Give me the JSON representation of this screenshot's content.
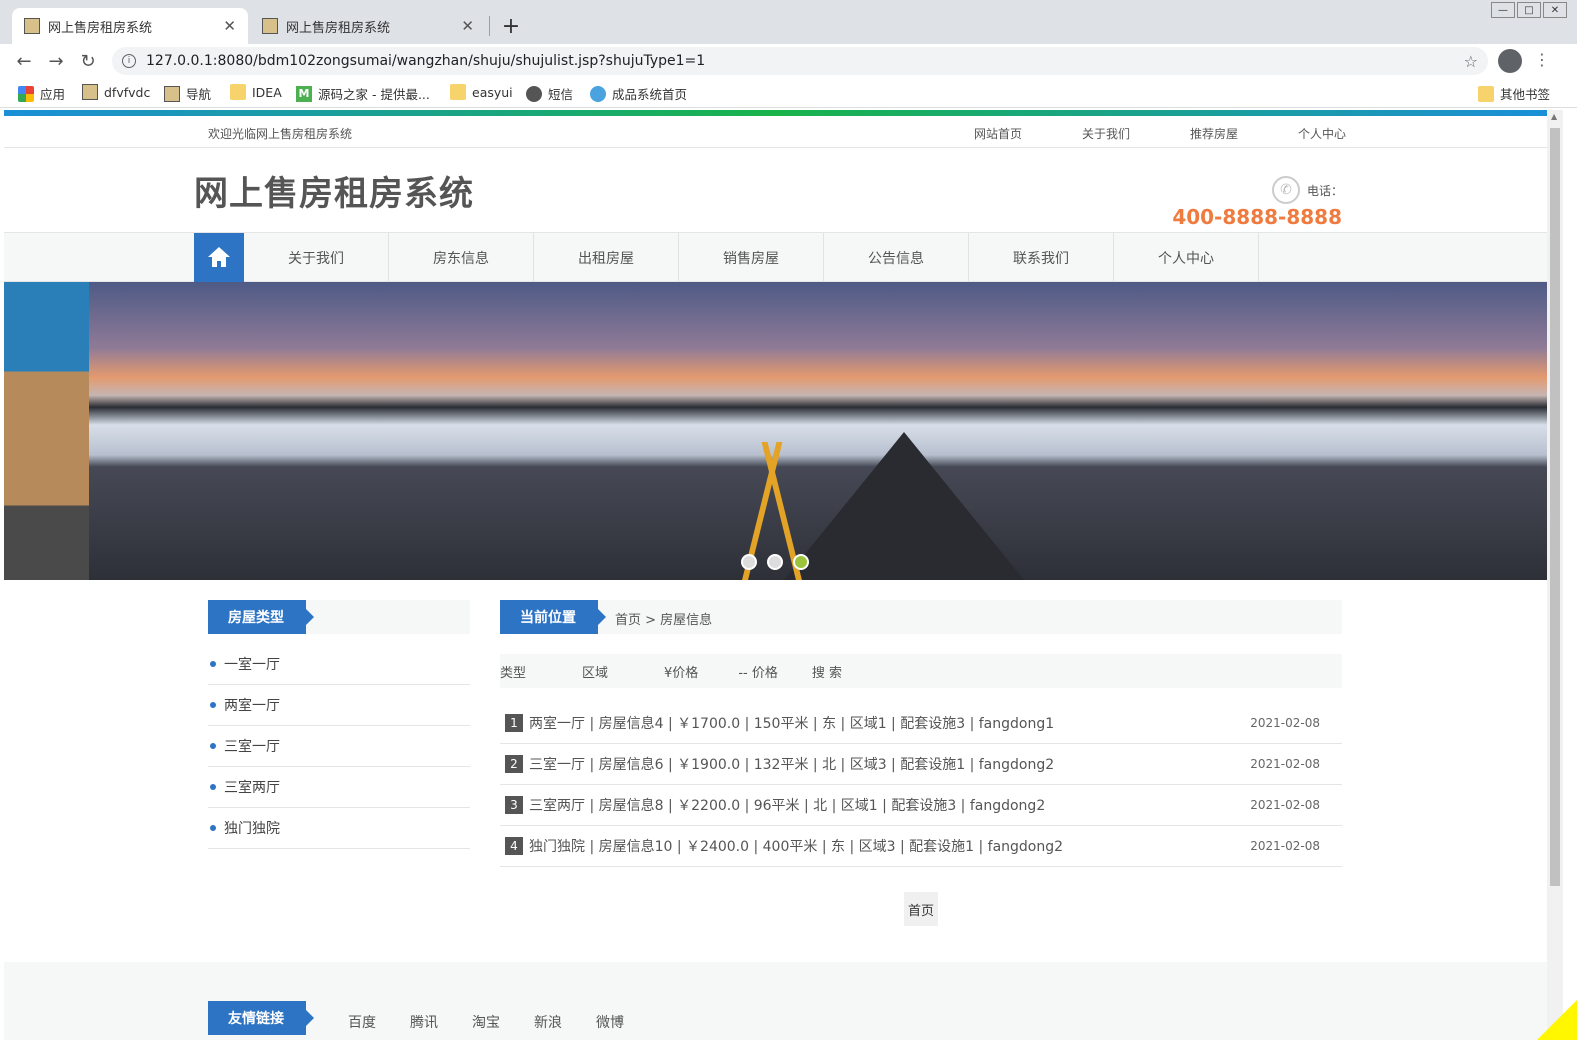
{
  "browser": {
    "tabs": [
      {
        "title": "网上售房租房系统",
        "active": true
      },
      {
        "title": "网上售房租房系统",
        "active": false
      }
    ],
    "url": "127.0.0.1:8080/bdm102zongsumai/wangzhan/shuju/shujulist.jsp?shujuType1=1",
    "bookmarks": [
      {
        "label": "应用",
        "icon": "apps-icon"
      },
      {
        "label": "dfvfvdc",
        "icon": "image-icon"
      },
      {
        "label": "导航",
        "icon": "image-icon"
      },
      {
        "label": "IDEA",
        "icon": "folder-icon"
      },
      {
        "label": "源码之家 - 提供最...",
        "icon": "m-icon"
      },
      {
        "label": "easyui",
        "icon": "folder-icon"
      },
      {
        "label": "短信",
        "icon": "globe-icon"
      },
      {
        "label": "成品系统首页",
        "icon": "house-icon"
      }
    ],
    "other_bookmarks": "其他书签"
  },
  "site": {
    "welcome": "欢迎光临网上售房租房系统",
    "top_links": [
      "网站首页",
      "关于我们",
      "推荐房屋",
      "个人中心"
    ],
    "title": "网上售房租房系统",
    "phone_label": "电话：",
    "phone_number": "400-8888-8888",
    "nav_items": [
      "关于我们",
      "房东信息",
      "出租房屋",
      "销售房屋",
      "公告信息",
      "联系我们",
      "个人中心"
    ],
    "accent_color": "#2d74c4",
    "phone_color": "#f07b3f"
  },
  "sidebar": {
    "title": "房屋类型",
    "items": [
      "一室一厅",
      "两室一厅",
      "三室一厅",
      "三室两厅",
      "独门独院"
    ]
  },
  "main": {
    "location_label": "当前位置",
    "breadcrumb": "首页 > 房屋信息",
    "search": {
      "type_label": "类型",
      "area_label": "区域",
      "price_from_label": "¥价格",
      "price_to_label": "-- 价格",
      "button": "搜 索"
    },
    "rows": [
      {
        "num": "1",
        "text": "两室一厅 | 房屋信息4 | ￥1700.0 | 150平米 | 东 | 区域1 | 配套设施3 | fangdong1",
        "date": "2021-02-08"
      },
      {
        "num": "2",
        "text": "三室一厅 | 房屋信息6 | ￥1900.0 | 132平米 | 北 | 区域3 | 配套设施1 | fangdong2",
        "date": "2021-02-08"
      },
      {
        "num": "3",
        "text": "三室两厅 | 房屋信息8 | ￥2200.0 | 96平米 | 北 | 区域1 | 配套设施3 | fangdong2",
        "date": "2021-02-08"
      },
      {
        "num": "4",
        "text": "独门独院 | 房屋信息10 | ￥2400.0 | 400平米 | 东 | 区域3 | 配套设施1 | fangdong2",
        "date": "2021-02-08"
      }
    ],
    "pager": "首页"
  },
  "footer": {
    "title": "友情链接",
    "links": [
      "百度",
      "腾讯",
      "淘宝",
      "新浪",
      "微博"
    ]
  }
}
